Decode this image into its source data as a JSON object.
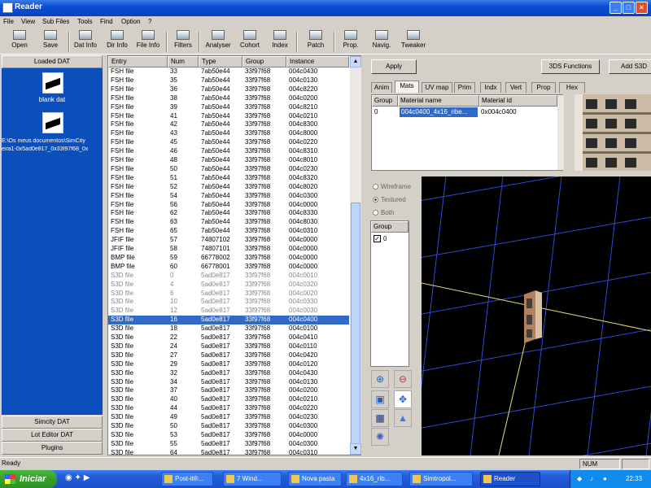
{
  "window": {
    "title": "Reader"
  },
  "menu": [
    "File",
    "View",
    "Sub Files",
    "Tools",
    "Find",
    "Option",
    "?"
  ],
  "toolbar": [
    {
      "label": "Open",
      "icon": "open-icon"
    },
    {
      "label": "Save",
      "icon": "save-icon"
    },
    {
      "label": "Dat Info",
      "icon": "dat-info-icon"
    },
    {
      "label": "Dir Info",
      "icon": "dir-info-icon"
    },
    {
      "label": "File Info",
      "icon": "file-info-icon"
    },
    {
      "label": "Filters",
      "icon": "filters-icon"
    },
    {
      "label": "Analyser",
      "icon": "analyser-icon"
    },
    {
      "label": "Cohort",
      "icon": "cohort-icon"
    },
    {
      "label": "Index",
      "icon": "index-icon"
    },
    {
      "label": "Patch",
      "icon": "patch-icon"
    },
    {
      "label": "Prop.",
      "icon": "prop-icon"
    },
    {
      "label": "Navig.",
      "icon": "navig-icon"
    },
    {
      "label": "Tweaker",
      "icon": "tweaker-icon"
    }
  ],
  "left": {
    "loaded_header": "Loaded DAT",
    "item1": "blank dat",
    "item2_line1": "E:\\Os meus documentos\\SimCity",
    "item2_line2": "eira1-0x5ad0e817_0x33f97f68_0x",
    "simcity": "Simcity DAT",
    "lot_editor": "Lot Editor DAT",
    "plugins": "Plugins"
  },
  "list": {
    "columns": [
      "Entry",
      "Num",
      "Type",
      "Group",
      "Instance"
    ],
    "rows": [
      [
        "FSH file",
        "33",
        "7ab50e44",
        "33f97f68",
        "004c0430"
      ],
      [
        "FSH file",
        "35",
        "7ab50e44",
        "33f97f68",
        "004c0130"
      ],
      [
        "FSH file",
        "36",
        "7ab50e44",
        "33f97f68",
        "004c8220"
      ],
      [
        "FSH file",
        "38",
        "7ab50e44",
        "33f97f68",
        "004c0200"
      ],
      [
        "FSH file",
        "39",
        "7ab50e44",
        "33f97f68",
        "004c8210"
      ],
      [
        "FSH file",
        "41",
        "7ab50e44",
        "33f97f68",
        "004c0210"
      ],
      [
        "FSH file",
        "42",
        "7ab50e44",
        "33f97f68",
        "004c8300"
      ],
      [
        "FSH file",
        "43",
        "7ab50e44",
        "33f97f68",
        "004c8000"
      ],
      [
        "FSH file",
        "45",
        "7ab50e44",
        "33f97f68",
        "004c0220"
      ],
      [
        "FSH file",
        "46",
        "7ab50e44",
        "33f97f68",
        "004c8310"
      ],
      [
        "FSH file",
        "48",
        "7ab50e44",
        "33f97f68",
        "004c8010"
      ],
      [
        "FSH file",
        "50",
        "7ab50e44",
        "33f97f68",
        "004c0230"
      ],
      [
        "FSH file",
        "51",
        "7ab50e44",
        "33f97f68",
        "004c8320"
      ],
      [
        "FSH file",
        "52",
        "7ab50e44",
        "33f97f68",
        "004c8020"
      ],
      [
        "FSH file",
        "54",
        "7ab50e44",
        "33f97f68",
        "004c0300"
      ],
      [
        "FSH file",
        "56",
        "7ab50e44",
        "33f97f68",
        "004c0000"
      ],
      [
        "FSH file",
        "62",
        "7ab50e44",
        "33f97f68",
        "004c8330"
      ],
      [
        "FSH file",
        "63",
        "7ab50e44",
        "33f97f68",
        "004c8030"
      ],
      [
        "FSH file",
        "65",
        "7ab50e44",
        "33f97f68",
        "004c0310"
      ],
      [
        "JFIF file",
        "57",
        "74807102",
        "33f97f68",
        "004c0000"
      ],
      [
        "JFIF file",
        "58",
        "74807101",
        "33f97f68",
        "004c0000"
      ],
      [
        "BMP file",
        "59",
        "66778002",
        "33f97f68",
        "004c0000"
      ],
      [
        "BMP file",
        "60",
        "66778001",
        "33f97f68",
        "004c0000"
      ],
      [
        "S3D file",
        "0",
        "5ad0e817",
        "33f97f68",
        "004c0010"
      ],
      [
        "S3D file",
        "4",
        "5ad0e817",
        "33f97f68",
        "004c0320"
      ],
      [
        "S3D file",
        "6",
        "5ad0e817",
        "33f97f68",
        "004c0020"
      ],
      [
        "S3D file",
        "10",
        "5ad0e817",
        "33f97f68",
        "004c0330"
      ],
      [
        "S3D file",
        "12",
        "5ad0e817",
        "33f97f68",
        "004c0030"
      ],
      [
        "S3D file",
        "16",
        "5ad0e817",
        "33f97f68",
        "004c0400"
      ],
      [
        "S3D file",
        "18",
        "5ad0e817",
        "33f97f68",
        "004c0100"
      ],
      [
        "S3D file",
        "22",
        "5ad0e817",
        "33f97f68",
        "004c0410"
      ],
      [
        "S3D file",
        "24",
        "5ad0e817",
        "33f97f68",
        "004c0110"
      ],
      [
        "S3D file",
        "27",
        "5ad0e817",
        "33f97f68",
        "004c0420"
      ],
      [
        "S3D file",
        "29",
        "5ad0e817",
        "33f97f68",
        "004c0120"
      ],
      [
        "S3D file",
        "32",
        "5ad0e817",
        "33f97f68",
        "004c0430"
      ],
      [
        "S3D file",
        "34",
        "5ad0e817",
        "33f97f68",
        "004c0130"
      ],
      [
        "S3D file",
        "37",
        "5ad0e817",
        "33f97f68",
        "004c0200"
      ],
      [
        "S3D file",
        "40",
        "5ad0e817",
        "33f97f68",
        "004c0210"
      ],
      [
        "S3D file",
        "44",
        "5ad0e817",
        "33f97f68",
        "004c0220"
      ],
      [
        "S3D file",
        "49",
        "5ad0e817",
        "33f97f68",
        "004c0230"
      ],
      [
        "S3D file",
        "50",
        "5ad0e817",
        "33f97f68",
        "004c0300"
      ],
      [
        "S3D file",
        "53",
        "5ad0e817",
        "33f97f68",
        "004c0000"
      ],
      [
        "S3D file",
        "55",
        "5ad0e817",
        "33f97f68",
        "004c0300"
      ],
      [
        "S3D file",
        "64",
        "5ad0e817",
        "33f97f68",
        "004c0310"
      ]
    ],
    "selected_index": 28,
    "dim_indices": [
      23,
      24,
      25,
      26,
      27
    ]
  },
  "right": {
    "apply": "Apply",
    "functions": "3DS Functions",
    "add": "Add S3D",
    "tabs": [
      "Anim",
      "Mats",
      "UV map",
      "Prim",
      "Indx",
      "Vert",
      "Prop",
      "Hex"
    ],
    "active_tab": "Mats",
    "mats_columns": [
      "Group",
      "Material name",
      "Material id"
    ],
    "mats_row": [
      "0",
      "004c0400_4x16_ribe...",
      "0x004c0400"
    ],
    "view_modes": [
      "Wireframe",
      "Textured",
      "Both"
    ],
    "selected_view_mode": "Textured",
    "group_header": "Group",
    "group_item": "0"
  },
  "status": {
    "text": "Ready",
    "num": "NUM"
  },
  "taskbar": {
    "start": "Iniciar",
    "tasks": [
      "Post-it®...",
      "7 Wind...",
      "Nova pasta",
      "4x16_rib...",
      "Simtropol...",
      "Reader"
    ],
    "active_task": "Reader",
    "clock": "22:33"
  }
}
